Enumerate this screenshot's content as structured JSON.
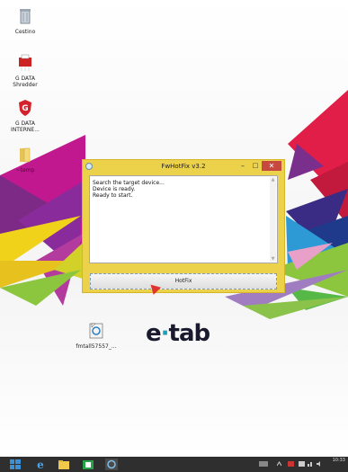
{
  "desktop": {
    "icons": [
      {
        "label": "Cestino",
        "icon": "recycle-bin-icon"
      },
      {
        "label": "G DATA Shredder",
        "icon": "shredder-icon"
      },
      {
        "label": "G DATA INTERNE...",
        "icon": "gdata-shield-icon"
      },
      {
        "label": "~temp",
        "icon": "folder-icon"
      },
      {
        "label": "fmtall57557_...",
        "icon": "installer-icon"
      }
    ],
    "logo_text_e": "e",
    "logo_text_dot": "·",
    "logo_text_tab": "tab"
  },
  "window": {
    "title": "FwHotFix  v3.2",
    "minimize_glyph": "–",
    "maximize_glyph": "□",
    "close_glyph": "✕",
    "log_lines": "Search the target device...\nDevice is ready.\nReady to start.",
    "hotfix_label": "HotFix",
    "accent_color": "#ecd14a"
  },
  "taskbar": {
    "items": [
      "start-icon",
      "internet-explorer-icon",
      "file-explorer-icon",
      "store-icon",
      "fwhotfix-app-icon"
    ],
    "clock_time": "10:33",
    "clock_date": ""
  }
}
